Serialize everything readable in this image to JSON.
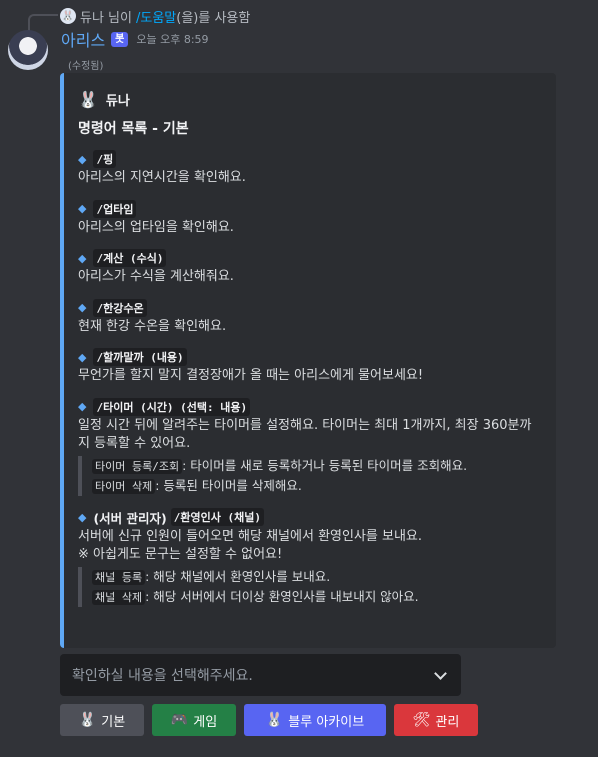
{
  "reply": {
    "avatar_emoji": "🐰",
    "user": "듀나 님이",
    "command": "/도움말",
    "suffix": "(을)를 사용함"
  },
  "message": {
    "username": "아리스",
    "bot_tag": "봇",
    "timestamp": "오늘 오후 8:59",
    "edited": "(수정됨)"
  },
  "embed": {
    "author_icon": "🐰",
    "author": "듀나",
    "title": "명령어 목록 - 기본",
    "accent_color": "#5fa8f5",
    "fields": [
      {
        "icon": "🔹",
        "name": "/핑",
        "value": "아리스의 지연시간을 확인해요."
      },
      {
        "icon": "🔹",
        "name": "/업타임",
        "value": "아리스의 업타임을 확인해요."
      },
      {
        "icon": "🔹",
        "name": "/계산 (수식)",
        "value": "아리스가 수식을 계산해줘요."
      },
      {
        "icon": "🔹",
        "name": "/한강수온",
        "value": "현재 한강 수온을 확인해요."
      },
      {
        "icon": "🔹",
        "name": "/할까말까 (내용)",
        "value": "무언가를 할지 말지 결정장애가 올 때는 아리스에게 물어보세요!"
      },
      {
        "icon": "🔹",
        "name": "/타이머 (시간) (선택: 내용)",
        "value": "일정 시간 뒤에 알려주는 타이머를 설정해요. 타이머는 최대 1개까지, 최장 360분까지 등록할 수 있어요.",
        "quote": [
          {
            "code": "타이머 등록/조회",
            "text": ": 타이머를 새로 등록하거나 등록된 타이머를 조회해요."
          },
          {
            "code": "타이머 삭제",
            "text": ": 등록된 타이머를 삭제해요."
          }
        ]
      },
      {
        "icon": "🔹",
        "prefix": "(서버 관리자)",
        "name": "/환영인사 (채널)",
        "value": "서버에 신규 인원이 들어오면 해당 채널에서 환영인사를 보내요.",
        "note": "※ 아쉽게도 문구는 설정할 수 없어요!",
        "quote": [
          {
            "code": "채널 등록",
            "text": ": 해당 채널에서 환영인사를 보내요."
          },
          {
            "code": "채널 삭제",
            "text": ": 해당 서버에서 더이상 환영인사를 내보내지 않아요."
          }
        ]
      }
    ]
  },
  "select": {
    "placeholder": "확인하실 내용을 선택해주세요."
  },
  "buttons": [
    {
      "emoji": "🐰",
      "label": "기본",
      "color": "#4e5058"
    },
    {
      "emoji": "🎮",
      "label": "게임",
      "color": "#248046"
    },
    {
      "emoji": "🐰",
      "label": "블루 아카이브",
      "color": "#5865f2"
    },
    {
      "emoji": "🛠",
      "label": "관리",
      "color": "#da373c"
    }
  ]
}
